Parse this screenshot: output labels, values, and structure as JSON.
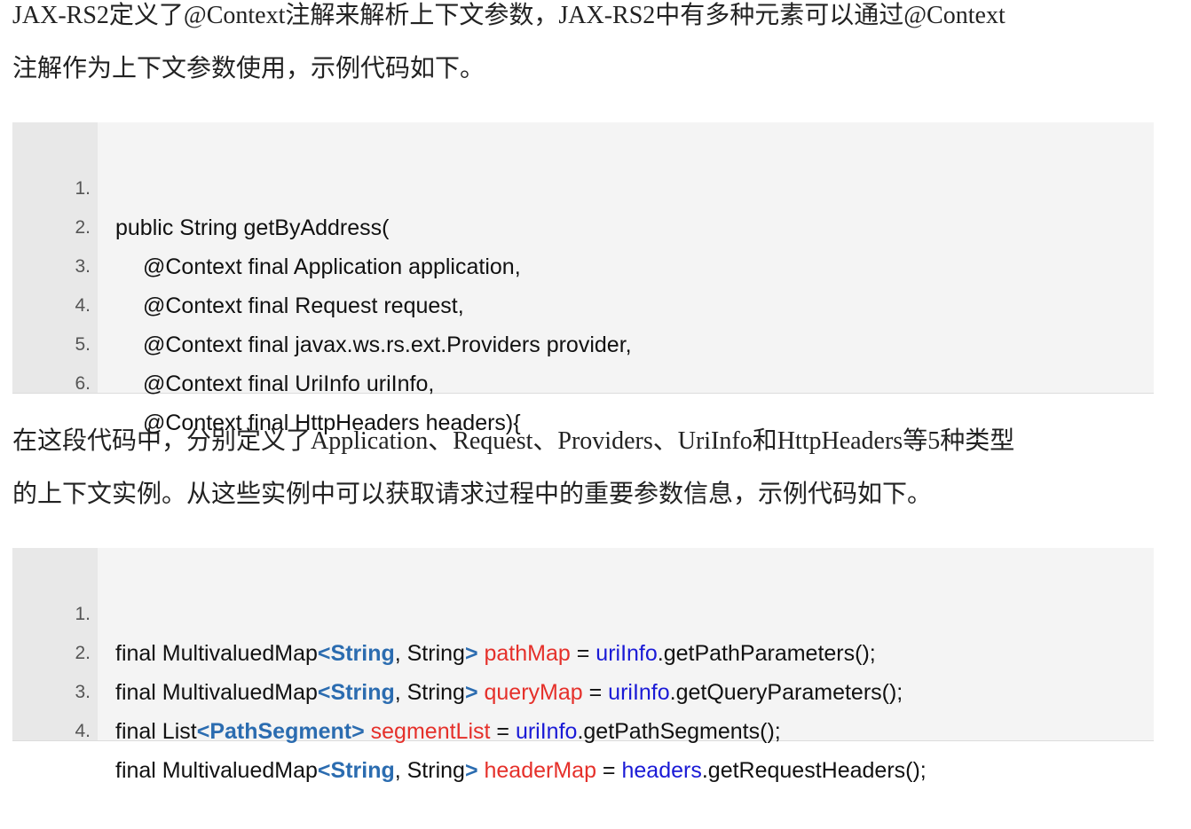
{
  "paragraphs": [
    {
      "line1": "JAX-RS2定义了@Context注解来解析上下文参数，JAX-RS2中有多种元素可以通过@Context",
      "line2": "注解作为上下文参数使用，示例代码如下。"
    },
    {
      "line1": "在这段代码中，分别定义了Application、Request、Providers、UriInfo和HttpHeaders等5种类型",
      "line2": "的上下文实例。从这些实例中可以获取请求过程中的重要参数信息，示例代码如下。"
    }
  ],
  "code_block_1": {
    "lines": [
      {
        "num": "1.",
        "text": "public String getByAddress("
      },
      {
        "num": "2.",
        "text": "@Context final Application application,"
      },
      {
        "num": "3.",
        "text": "@Context final Request request,"
      },
      {
        "num": "4.",
        "text": "@Context final javax.ws.rs.ext.Providers provider,"
      },
      {
        "num": "5.",
        "text": "@Context final UriInfo uriInfo,"
      },
      {
        "num": "6.",
        "text": "@Context final HttpHeaders headers){"
      }
    ]
  },
  "code_block_2": {
    "lines": [
      {
        "num": "1.",
        "pre": "final MultivaluedMap",
        "lt": "<",
        "type": "String",
        "mid": ", String",
        "gt": ">",
        "sp1": " ",
        "var": "pathMap",
        "eq": " = ",
        "obj": "uriInfo",
        "call": ".getPathParameters();"
      },
      {
        "num": "2.",
        "pre": "final MultivaluedMap",
        "lt": "<",
        "type": "String",
        "mid": ", String",
        "gt": ">",
        "sp1": " ",
        "var": "queryMap",
        "eq": " = ",
        "obj": "uriInfo",
        "call": ".getQueryParameters();"
      },
      {
        "num": "3.",
        "pre": "final List",
        "lt": "<",
        "type": "PathSegment",
        "mid": "",
        "gt": ">",
        "sp1": " ",
        "var": "segmentList",
        "eq": " = ",
        "obj": "uriInfo",
        "call": ".getPathSegments();"
      },
      {
        "num": "4.",
        "pre": "final MultivaluedMap",
        "lt": "<",
        "type": "String",
        "mid": ", String",
        "gt": ">",
        "sp1": " ",
        "var": "headerMap",
        "eq": " = ",
        "obj": "headers",
        "call": ".getRequestHeaders();"
      }
    ]
  },
  "colors": {
    "type_keyword": "#2b6cb0",
    "variable": "#e5302a",
    "object_ref": "#1a1ad6",
    "code_background": "#f4f4f4",
    "gutter_background": "#e8e8e8"
  }
}
